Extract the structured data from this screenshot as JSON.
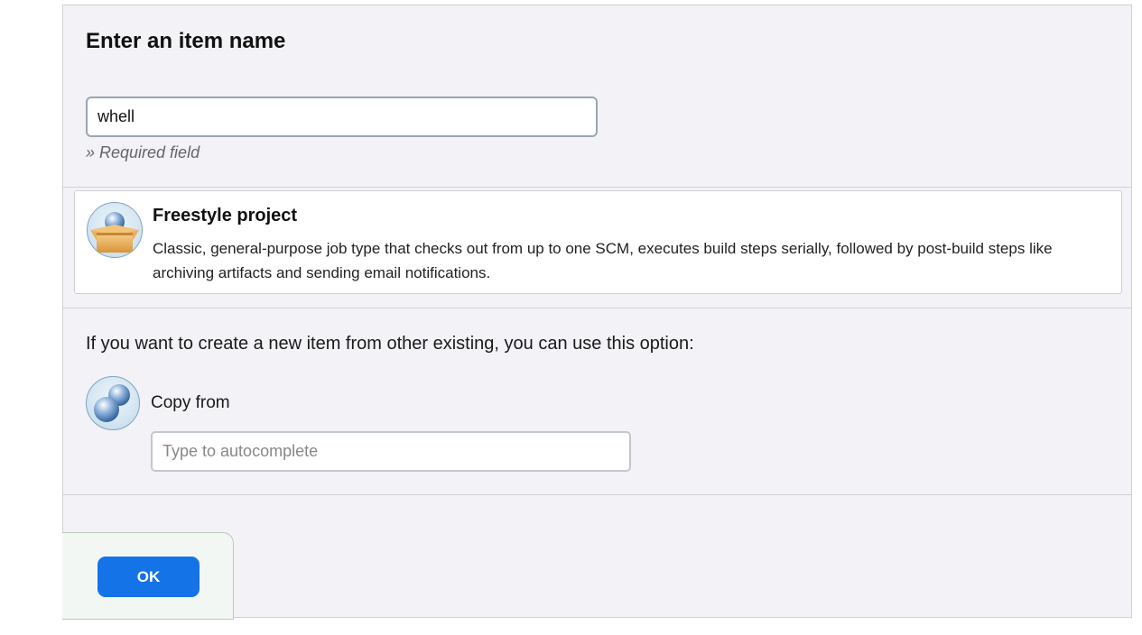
{
  "form": {
    "heading": "Enter an item name",
    "item_name_value": "whell",
    "required_note": "» Required field"
  },
  "item_types": [
    {
      "icon": "freestyle-project-icon",
      "title": "Freestyle project",
      "description": "Classic, general-purpose job type that checks out from up to one SCM, executes build steps serially, followed by post-build steps like archiving artifacts and sending email notifications."
    }
  ],
  "copy": {
    "intro": "If you want to create a new item from other existing, you can use this option:",
    "icon": "copy-from-icon",
    "label": "Copy from",
    "placeholder": "Type to autocomplete",
    "value": ""
  },
  "actions": {
    "ok_label": "OK"
  },
  "colors": {
    "accent": "#1473e6",
    "panel_bg": "#f2f2f7"
  }
}
